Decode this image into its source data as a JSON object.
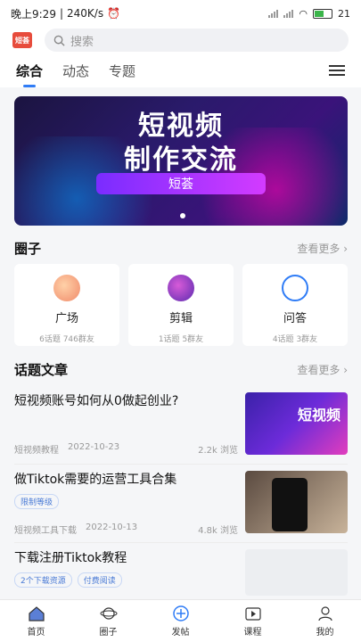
{
  "status_bar": {
    "time": "晚上9:29",
    "network_speed": "240K/s",
    "battery": "21"
  },
  "header": {
    "logo_text": "短荟",
    "search_placeholder": "搜索"
  },
  "tabs": [
    {
      "label": "综合",
      "active": true
    },
    {
      "label": "动态",
      "active": false
    },
    {
      "label": "专题",
      "active": false
    }
  ],
  "banner": {
    "title_line1": "短视频",
    "title_line2": "制作交流",
    "button": "短荟"
  },
  "circles": {
    "title": "圈子",
    "more": "查看更多 ›",
    "items": [
      {
        "name": "广场",
        "topics": "6话题",
        "members": "746群友",
        "color": "#f4a27a"
      },
      {
        "name": "剪辑",
        "topics": "1话题",
        "members": "5群友",
        "color": "#8a3fd1"
      },
      {
        "name": "问答",
        "topics": "4话题",
        "members": "3群友",
        "color": "#2f7cf6"
      }
    ]
  },
  "articles": {
    "title": "话题文章",
    "more": "查看更多 ›",
    "items": [
      {
        "title": "短视频账号如何从0做起创业?",
        "category": "短视频教程",
        "date": "2022-10-23",
        "views": "2.2k 浏览",
        "thumb_text": "短视频",
        "tags": []
      },
      {
        "title": "做Tiktok需要的运营工具合集",
        "category": "短视频工具下载",
        "date": "2022-10-13",
        "views": "4.8k 浏览",
        "tags": [
          "限制等级"
        ]
      },
      {
        "title": "下载注册Tiktok教程",
        "tags": [
          "2个下载资源",
          "付费阅读"
        ]
      }
    ]
  },
  "bottom_nav": [
    {
      "label": "首页",
      "icon": "home-icon"
    },
    {
      "label": "圈子",
      "icon": "planet-icon"
    },
    {
      "label": "发帖",
      "icon": "plus-circle-icon"
    },
    {
      "label": "课程",
      "icon": "play-box-icon"
    },
    {
      "label": "我的",
      "icon": "user-icon"
    }
  ]
}
